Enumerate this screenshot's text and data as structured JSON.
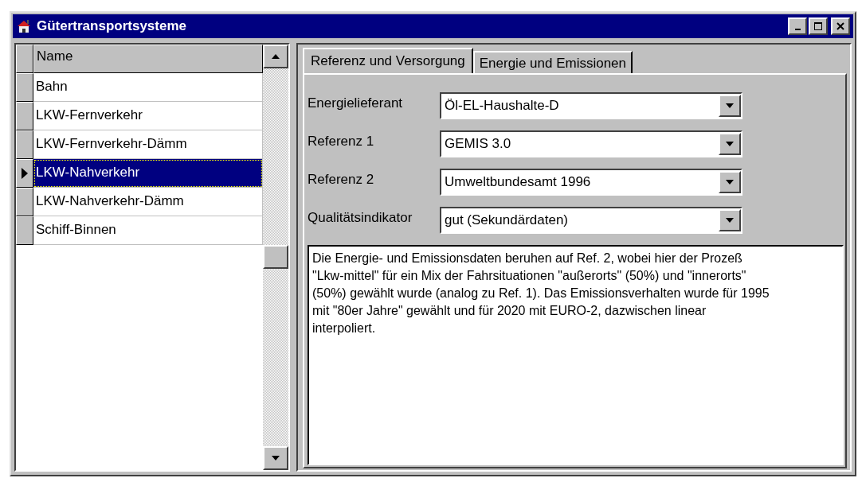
{
  "window": {
    "title": "Gütertransportsysteme"
  },
  "grid": {
    "column": "Name",
    "rows": [
      {
        "name": "Bahn",
        "selected": false
      },
      {
        "name": "LKW-Fernverkehr",
        "selected": false
      },
      {
        "name": "LKW-Fernverkehr-Dämm",
        "selected": false
      },
      {
        "name": "LKW-Nahverkehr",
        "selected": true
      },
      {
        "name": "LKW-Nahverkehr-Dämm",
        "selected": false
      },
      {
        "name": "Schiff-Binnen",
        "selected": false
      }
    ]
  },
  "tabs": [
    {
      "label": "Referenz und Versorgung",
      "selected": true
    },
    {
      "label": "Energie und Emissionen",
      "selected": false
    }
  ],
  "fields": [
    {
      "label": "Energielieferant",
      "value": "Öl-EL-Haushalte-D"
    },
    {
      "label": "Referenz 1",
      "value": "GEMIS 3.0"
    },
    {
      "label": "Referenz 2",
      "value": "Umweltbundesamt 1996"
    },
    {
      "label": "Qualitätsindikator",
      "value": "gut (Sekundärdaten)"
    }
  ],
  "memo": "Die Energie- und Emissionsdaten beruhen auf Ref. 2, wobei hier der Prozeß \"Lkw-mittel\" für ein Mix der Fahrsituationen \"außerorts\" (50%) und \"innerorts\" (50%) gewählt wurde (analog zu Ref. 1). Das Emissionsverhalten wurde für 1995 mit \"80er Jahre\" gewählt und für 2020 mit EURO-2, dazwischen linear interpoliert."
}
